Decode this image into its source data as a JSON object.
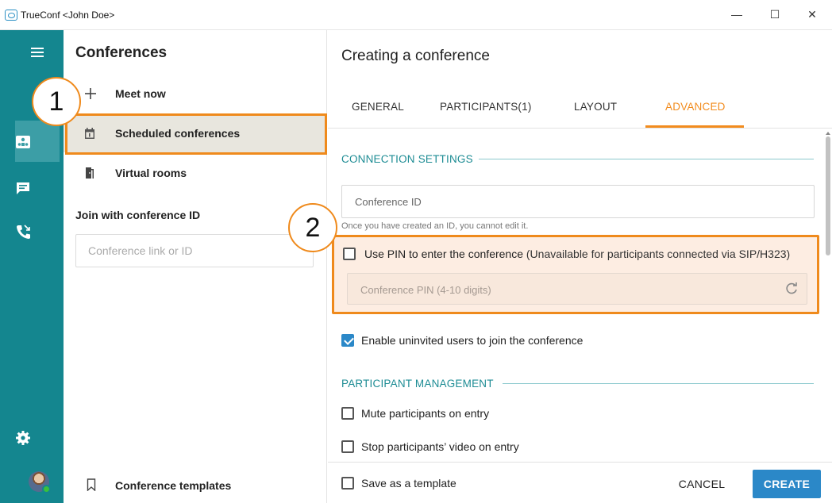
{
  "window": {
    "title": "TrueConf <John Doe>",
    "minimize": "—",
    "maximize": "☐",
    "close": "✕"
  },
  "rail": {
    "items": [
      "menu-icon",
      "conferences-icon",
      "chat-icon",
      "calls-icon",
      "settings-icon",
      "avatar"
    ]
  },
  "conferences": {
    "title": "Conferences",
    "menu": [
      {
        "label": "Meet now",
        "icon": "plus-icon"
      },
      {
        "label": "Scheduled conferences",
        "icon": "calendar-icon"
      },
      {
        "label": "Virtual rooms",
        "icon": "door-icon"
      }
    ],
    "join_title": "Join with conference ID",
    "join_placeholder": "Conference link or ID",
    "templates_label": "Conference templates"
  },
  "main": {
    "title": "Creating a conference",
    "tabs": [
      "GENERAL",
      "PARTICIPANTS(1)",
      "LAYOUT",
      "ADVANCED"
    ],
    "active_tab": "ADVANCED",
    "connection_settings": {
      "title": "CONNECTION SETTINGS",
      "conference_id_placeholder": "Conference ID",
      "hint": "Once you have created an ID, you cannot edit it.",
      "use_pin_label": "Use PIN to enter the conference",
      "use_pin_note": "(Unavailable for participants connected via SIP/H323)",
      "use_pin_checked": false,
      "pin_placeholder": "Conference PIN (4-10 digits)",
      "uninvited_label": "Enable uninvited users to join the conference",
      "uninvited_checked": true
    },
    "participant_management": {
      "title": "PARTICIPANT MANAGEMENT",
      "mute_label": "Mute participants on entry",
      "stop_video_label": "Stop participants’ video on entry"
    },
    "footer": {
      "save_template_label": "Save as a template",
      "cancel_label": "CANCEL",
      "create_label": "CREATE"
    }
  },
  "callouts": [
    "1",
    "2"
  ],
  "colors": {
    "rail": "#14868f",
    "accent_orange": "#ef8a1c",
    "primary_blue": "#2b88c8",
    "section_teal": "#1d8c94"
  }
}
